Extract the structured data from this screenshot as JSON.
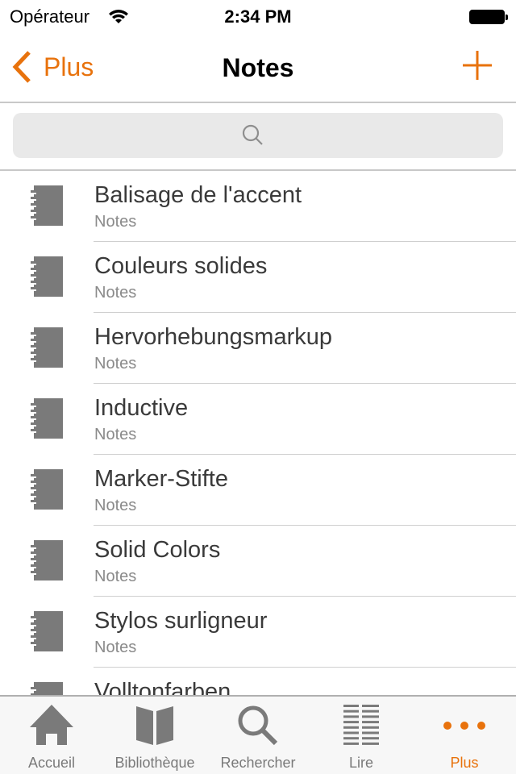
{
  "status": {
    "carrier": "Opérateur",
    "time": "2:34 PM"
  },
  "nav": {
    "back_label": "Plus",
    "title": "Notes"
  },
  "colors": {
    "accent": "#e8720c",
    "icon_gray": "#7a7a7a"
  },
  "search": {
    "placeholder": ""
  },
  "notes": [
    {
      "title": "Balisage de l'accent",
      "subtitle": "Notes"
    },
    {
      "title": "Couleurs solides",
      "subtitle": "Notes"
    },
    {
      "title": "Hervorhebungsmarkup",
      "subtitle": "Notes"
    },
    {
      "title": "Inductive",
      "subtitle": "Notes"
    },
    {
      "title": "Marker-Stifte",
      "subtitle": "Notes"
    },
    {
      "title": "Solid Colors",
      "subtitle": "Notes"
    },
    {
      "title": "Stylos surligneur",
      "subtitle": "Notes"
    },
    {
      "title": "Volltonfarben",
      "subtitle": ""
    }
  ],
  "tabs": [
    {
      "label": "Accueil",
      "icon": "home-icon"
    },
    {
      "label": "Bibliothèque",
      "icon": "book-icon"
    },
    {
      "label": "Rechercher",
      "icon": "search-icon"
    },
    {
      "label": "Lire",
      "icon": "list-icon"
    },
    {
      "label": "Plus",
      "icon": "more-icon",
      "active": true
    }
  ]
}
